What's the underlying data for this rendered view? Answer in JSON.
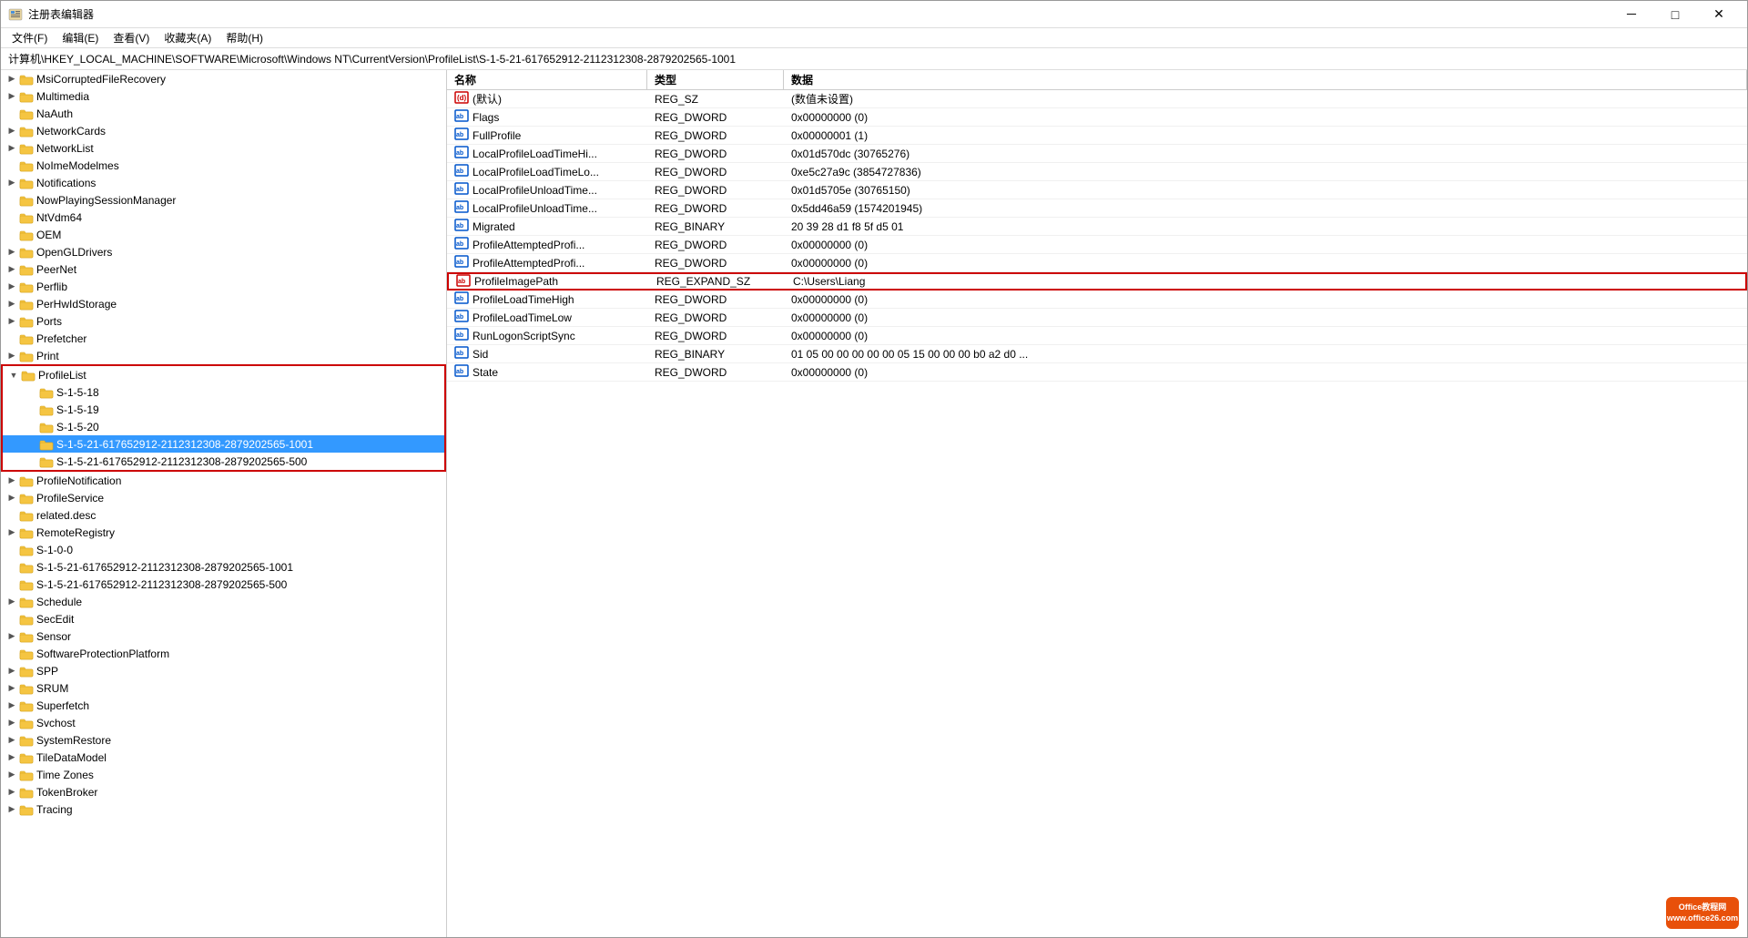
{
  "window": {
    "title": "注册表编辑器",
    "controls": {
      "minimize": "－",
      "maximize": "□",
      "close": "✕"
    }
  },
  "menu": {
    "items": [
      "文件(F)",
      "编辑(E)",
      "查看(V)",
      "收藏夹(A)",
      "帮助(H)"
    ]
  },
  "breadcrumb": "计算机\\HKEY_LOCAL_MACHINE\\SOFTWARE\\Microsoft\\Windows NT\\CurrentVersion\\ProfileList\\S-1-5-21-617652912-2112312308-2879202565-1001",
  "tree": {
    "items": [
      {
        "level": 1,
        "label": "MsiCorruptedFileRecovery",
        "expandable": true,
        "expanded": false
      },
      {
        "level": 1,
        "label": "Multimedia",
        "expandable": true,
        "expanded": false
      },
      {
        "level": 1,
        "label": "NaAuth",
        "expandable": false,
        "expanded": false
      },
      {
        "level": 1,
        "label": "NetworkCards",
        "expandable": true,
        "expanded": false
      },
      {
        "level": 1,
        "label": "NetworkList",
        "expandable": true,
        "expanded": false
      },
      {
        "level": 1,
        "label": "NoImeModelmes",
        "expandable": false,
        "expanded": false
      },
      {
        "level": 1,
        "label": "Notifications",
        "expandable": true,
        "expanded": false
      },
      {
        "level": 1,
        "label": "NowPlayingSessionManager",
        "expandable": false,
        "expanded": false
      },
      {
        "level": 1,
        "label": "NtVdm64",
        "expandable": false,
        "expanded": false
      },
      {
        "level": 1,
        "label": "OEM",
        "expandable": false,
        "expanded": false
      },
      {
        "level": 1,
        "label": "OpenGLDrivers",
        "expandable": true,
        "expanded": false
      },
      {
        "level": 1,
        "label": "PeerNet",
        "expandable": true,
        "expanded": false
      },
      {
        "level": 1,
        "label": "Perflib",
        "expandable": true,
        "expanded": false
      },
      {
        "level": 1,
        "label": "PerHwIdStorage",
        "expandable": true,
        "expanded": false
      },
      {
        "level": 1,
        "label": "Ports",
        "expandable": true,
        "expanded": false
      },
      {
        "level": 1,
        "label": "Prefetcher",
        "expandable": false,
        "expanded": false
      },
      {
        "level": 1,
        "label": "Print",
        "expandable": true,
        "expanded": false
      },
      {
        "level": 1,
        "label": "ProfileList",
        "expandable": true,
        "expanded": true,
        "highlighted": true
      },
      {
        "level": 2,
        "label": "S-1-5-18",
        "expandable": false,
        "highlighted": true
      },
      {
        "level": 2,
        "label": "S-1-5-19",
        "expandable": false,
        "highlighted": true
      },
      {
        "level": 2,
        "label": "S-1-5-20",
        "expandable": false,
        "highlighted": true
      },
      {
        "level": 2,
        "label": "S-1-5-21-617652912-2112312308-2879202565-1001",
        "expandable": false,
        "selected": true,
        "highlighted": true
      },
      {
        "level": 2,
        "label": "S-1-5-21-617652912-2112312308-2879202565-500",
        "expandable": false,
        "highlighted": true
      },
      {
        "level": 1,
        "label": "ProfileNotification",
        "expandable": true,
        "expanded": false
      },
      {
        "level": 1,
        "label": "ProfileService",
        "expandable": true,
        "expanded": false
      },
      {
        "level": 1,
        "label": "related.desc",
        "expandable": false,
        "expanded": false
      },
      {
        "level": 1,
        "label": "RemoteRegistry",
        "expandable": true,
        "expanded": false
      },
      {
        "level": 1,
        "label": "S-1-0-0",
        "expandable": false,
        "expanded": false
      },
      {
        "level": 1,
        "label": "S-1-5-21-617652912-2112312308-2879202565-1001",
        "expandable": false
      },
      {
        "level": 1,
        "label": "S-1-5-21-617652912-2112312308-2879202565-500",
        "expandable": false
      },
      {
        "level": 1,
        "label": "Schedule",
        "expandable": true,
        "expanded": false
      },
      {
        "level": 1,
        "label": "SecEdit",
        "expandable": false,
        "expanded": false
      },
      {
        "level": 1,
        "label": "Sensor",
        "expandable": true,
        "expanded": false
      },
      {
        "level": 1,
        "label": "SoftwareProtectionPlatform",
        "expandable": false,
        "expanded": false
      },
      {
        "level": 1,
        "label": "SPP",
        "expandable": true,
        "expanded": false
      },
      {
        "level": 1,
        "label": "SRUM",
        "expandable": true,
        "expanded": false
      },
      {
        "level": 1,
        "label": "Superfetch",
        "expandable": true,
        "expanded": false
      },
      {
        "level": 1,
        "label": "Svchost",
        "expandable": true,
        "expanded": false
      },
      {
        "level": 1,
        "label": "SystemRestore",
        "expandable": true,
        "expanded": false
      },
      {
        "level": 1,
        "label": "TileDataModel",
        "expandable": true,
        "expanded": false
      },
      {
        "level": 1,
        "label": "Time Zones",
        "expandable": true,
        "expanded": false
      },
      {
        "level": 1,
        "label": "TokenBroker",
        "expandable": true,
        "expanded": false
      },
      {
        "level": 1,
        "label": "Tracing",
        "expandable": true,
        "expanded": false
      }
    ]
  },
  "columns": {
    "name": "名称",
    "type": "类型",
    "data": "数据"
  },
  "values": [
    {
      "name": "(默认)",
      "type": "REG_SZ",
      "data": "(数值未设置)",
      "icon": "default"
    },
    {
      "name": "Flags",
      "type": "REG_DWORD",
      "data": "0x00000000 (0)",
      "icon": "dword"
    },
    {
      "name": "FullProfile",
      "type": "REG_DWORD",
      "data": "0x00000001 (1)",
      "icon": "dword"
    },
    {
      "name": "LocalProfileLoadTimeHi...",
      "type": "REG_DWORD",
      "data": "0x01d570dc (30765276)",
      "icon": "dword"
    },
    {
      "name": "LocalProfileLoadTimeLo...",
      "type": "REG_DWORD",
      "data": "0xe5c27a9c (3854727836)",
      "icon": "dword"
    },
    {
      "name": "LocalProfileUnloadTime...",
      "type": "REG_DWORD",
      "data": "0x01d5705e (30765150)",
      "icon": "dword"
    },
    {
      "name": "LocalProfileUnloadTime...",
      "type": "REG_DWORD",
      "data": "0x5dd46a59 (1574201945)",
      "icon": "dword"
    },
    {
      "name": "Migrated",
      "type": "REG_BINARY",
      "data": "20 39 28 d1 f8 5f d5 01",
      "icon": "binary"
    },
    {
      "name": "ProfileAttemptedProfi...",
      "type": "REG_DWORD",
      "data": "0x00000000 (0)",
      "icon": "dword"
    },
    {
      "name": "ProfileAttemptedProfi...",
      "type": "REG_DWORD",
      "data": "0x00000000 (0)",
      "icon": "dword"
    },
    {
      "name": "ProfileImagePath",
      "type": "REG_EXPAND_SZ",
      "data": "C:\\Users\\Liang",
      "icon": "expand",
      "highlight": true
    },
    {
      "name": "ProfileLoadTimeHigh",
      "type": "REG_DWORD",
      "data": "0x00000000 (0)",
      "icon": "dword"
    },
    {
      "name": "ProfileLoadTimeLow",
      "type": "REG_DWORD",
      "data": "0x00000000 (0)",
      "icon": "dword"
    },
    {
      "name": "RunLogonScriptSync",
      "type": "REG_DWORD",
      "data": "0x00000000 (0)",
      "icon": "dword"
    },
    {
      "name": "Sid",
      "type": "REG_BINARY",
      "data": "01 05 00 00 00 00 00 05 15 00 00 00 b0 a2 d0 ...",
      "icon": "binary"
    },
    {
      "name": "State",
      "type": "REG_DWORD",
      "data": "0x00000000 (0)",
      "icon": "dword"
    }
  ],
  "office_badge": {
    "line1": "Office教程网",
    "line2": "www.office26.com"
  }
}
